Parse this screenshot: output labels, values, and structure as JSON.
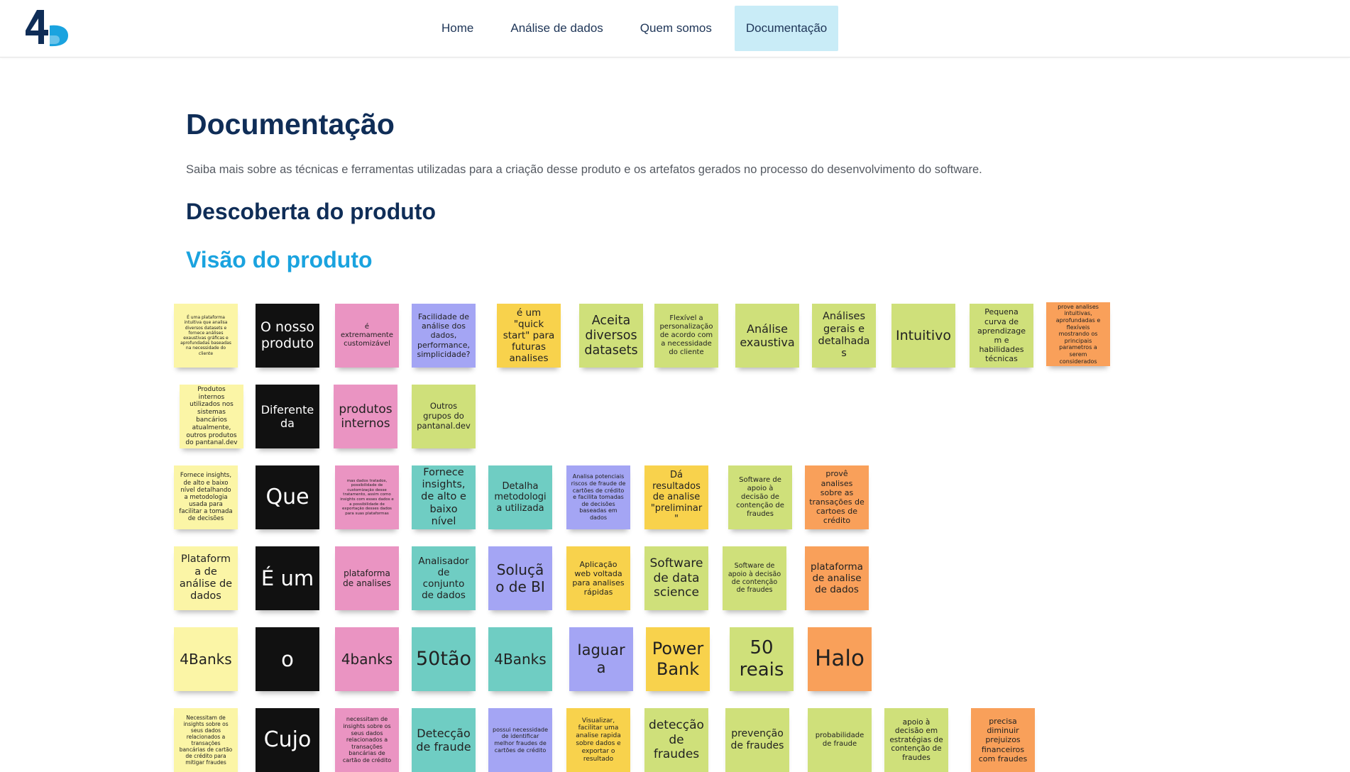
{
  "nav": {
    "items": [
      "Home",
      "Análise de dados",
      "Quem somos",
      "Documentação"
    ],
    "active": 3
  },
  "page": {
    "title": "Documentação",
    "intro": "Saiba mais sobre as técnicas e ferramentas utilizadas para a criação desse produto e os artefatos gerados no processo do desenvolvimento do software.",
    "section": "Descoberta do produto",
    "subsection": "Visão do produto"
  },
  "colors": {
    "navy": "#0f2d57",
    "accent": "#1aa3df",
    "active_tab": "#c9ecf7",
    "sticky_yellow_light": "#fbf5a6",
    "sticky_black": "#111111",
    "sticky_pink": "#ea94c2",
    "sticky_purple": "#a4a5f4",
    "sticky_yellow": "#f8d24c",
    "sticky_green": "#cfe07a",
    "sticky_orange": "#f9a05a",
    "sticky_teal": "#6fcdc3"
  },
  "sticky_rows": [
    [
      "É uma plataforma intuitiva que analisa diversos datasets e fornece análises exaustivas gráficas e aprofundadas baseadas na necessidade do cliente",
      "O nosso produto",
      "é extremamente customizável",
      "Facilidade de análise dos dados, performance, simplicidade?",
      "é um \"quick start\" para futuras analises",
      "Aceita diversos datasets",
      "Flexível a personalização de acordo com a necessidade do cliente",
      "Análise exaustiva",
      "Análises gerais e detalhadas",
      "Intuitivo",
      "Pequena curva de aprendizagem e habilidades técnicas",
      "prove analises intuitivas, aprofundadas e flexíveis mostrando os principais parametros a serem considerados"
    ],
    [
      "Produtos internos utilizados nos sistemas bancários atualmente, outros produtos do pantanal.dev",
      "Diferente da",
      "produtos internos",
      "Outros grupos do pantanal.dev"
    ],
    [
      "Fornece insights, de alto e baixo nível detalhando a metodologia usada para facilitar a tomada de decisões",
      "Que",
      "mas dados tratados, possibilidade de customização desse tratamento, assim como insights com esses dados e a possibilidade de exportação desses dados para suas plataformas",
      "Fornece insights, de alto e baixo nível",
      "Detalha metodologia utilizada",
      "Analisa potenciais riscos de fraude de cartões de crédito e facilita tomadas de decisões baseadas em dados",
      "Dá resultados de analise \"preliminar\"",
      "Software de apoio à decisão de contenção de fraudes",
      "provê analises sobre as transações de cartoes de crédito"
    ],
    [
      "Plataforma de análise de dados",
      "É um",
      "plataforma de analises",
      "Analisador de conjunto de dados",
      "Solução de BI",
      "Aplicação web voltada para analises rápidas",
      "Software de data science",
      "Software de apoio à decisão de contenção de fraudes",
      "plataforma de analise de dados"
    ],
    [
      "4Banks",
      "o",
      "4banks",
      "50tão",
      "4Banks",
      "Iaguara",
      "Power Bank",
      "50 reais",
      "Halo"
    ],
    [
      "Necessitam de insights sobre os seus dados relacionados a transações bancárias de cartão de crédito para mitigar fraudes",
      "Cujo",
      "necessitam de insights sobre os seus dados relacionados a transações bancárias de cartão de crédito",
      "Detecção de fraude",
      "possui necessidade de identificar melhor fraudes de cartões de crédito",
      "Visualizar, facilitar uma analise rapida sobre dados e exportar o resultado",
      "detecção de fraudes",
      "prevenção de fraudes",
      "probabilidade de fraude",
      "apoio à decisão em estratégias de contenção de fraudes",
      "precisa diminuir prejuizos financeiros com fraudes"
    ]
  ]
}
